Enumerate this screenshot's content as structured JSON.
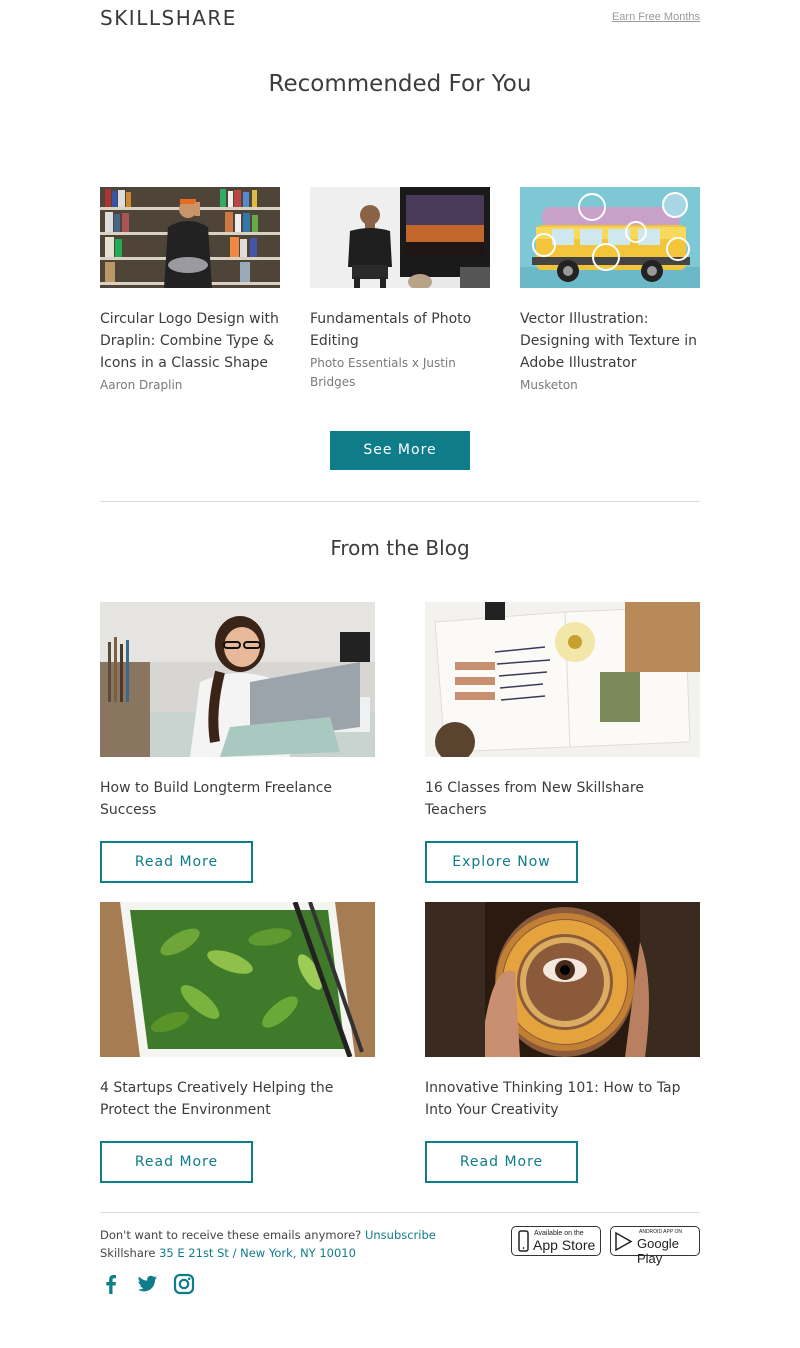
{
  "header": {
    "logo": "SKILLSHARE",
    "earn_link": "Earn Free Months"
  },
  "recommended": {
    "title": "Recommended For You",
    "classes": [
      {
        "title": "Circular Logo Design with Draplin: Combine Type & Icons in a Classic Shape",
        "author": "Aaron Draplin",
        "image": "bookshelf-man-photo"
      },
      {
        "title": "Fundamentals of Photo Editing",
        "author": "Photo Essentials x Justin Bridges",
        "image": "man-with-laptop-photo"
      },
      {
        "title": "Vector Illustration: Designing with Texture in Adobe Illustrator",
        "author": "Musketon",
        "image": "yellow-van-illustration"
      }
    ],
    "see_more": "See More"
  },
  "blog": {
    "title": "From the Blog",
    "posts": [
      {
        "title": "How to Build Longterm Freelance Success",
        "button": "Read More",
        "image": "woman-laptop-photo"
      },
      {
        "title": "16 Classes from New Skillshare Teachers",
        "button": "Explore Now",
        "image": "journal-collage-photo"
      },
      {
        "title": "4 Startups Creatively Helping the Protect the Environment",
        "button": "Read More",
        "image": "leaves-painting-photo"
      },
      {
        "title": "Innovative Thinking 101: How to Tap Into Your Creativity",
        "button": "Read More",
        "image": "fairy-lights-eye-photo"
      }
    ]
  },
  "footer": {
    "unsub_text": "Don't want to receive these emails anymore?",
    "unsub_link": "Unsubscribe",
    "company": "Skillshare",
    "address_street": "35 E 21st St",
    "address_sep": "/",
    "address_city": "New York, NY 10010",
    "app_store_small": "Available on the",
    "app_store_big": "App Store",
    "google_small": "ANDROID APP ON",
    "google_big": "Google Play"
  },
  "colors": {
    "accent": "#0f7c8a",
    "text": "#3c3c3c",
    "muted": "#7a7a7a"
  }
}
